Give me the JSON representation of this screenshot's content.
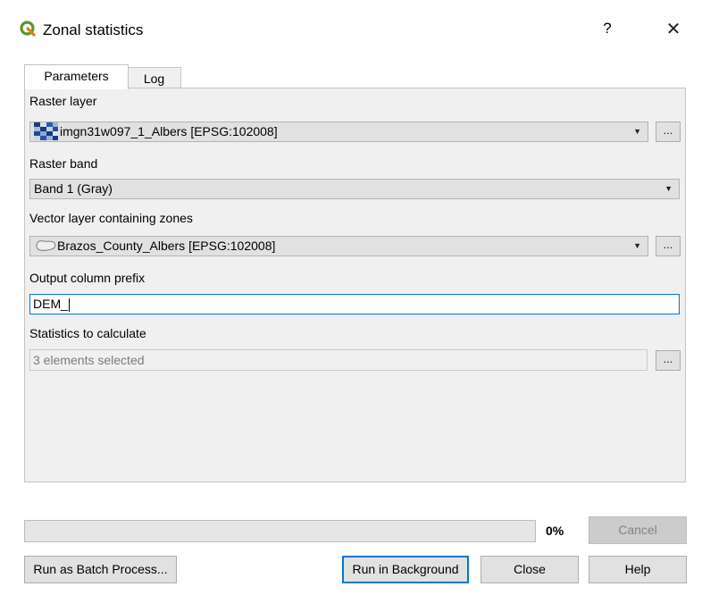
{
  "window": {
    "title": "Zonal statistics",
    "help": "?",
    "close": "✕"
  },
  "tabs": [
    {
      "label": "Parameters"
    },
    {
      "label": "Log"
    }
  ],
  "params": {
    "raster_layer_label": "Raster layer",
    "raster_layer_value": "imgn31w097_1_Albers [EPSG:102008]",
    "raster_band_label": "Raster band",
    "raster_band_value": "Band 1 (Gray)",
    "vector_layer_label": "Vector layer containing zones",
    "vector_layer_value": "Brazos_County_Albers [EPSG:102008]",
    "prefix_label": "Output column prefix",
    "prefix_value": "DEM_",
    "stats_label": "Statistics to calculate",
    "stats_value": "3 elements selected",
    "browse": "..."
  },
  "progress": {
    "percent_text": "0%",
    "value": 0
  },
  "buttons": {
    "cancel": "Cancel",
    "batch": "Run as Batch Process...",
    "background": "Run in Background",
    "close": "Close",
    "help": "Help"
  },
  "colors": {
    "accent": "#0078d7",
    "logo_green": "#589632",
    "logo_yellow": "#ee7913"
  },
  "icons": {
    "app": "qgis-logo-icon",
    "raster": "raster-layer-icon",
    "vector": "polygon-layer-icon",
    "dropdown": "chevron-down-icon"
  }
}
